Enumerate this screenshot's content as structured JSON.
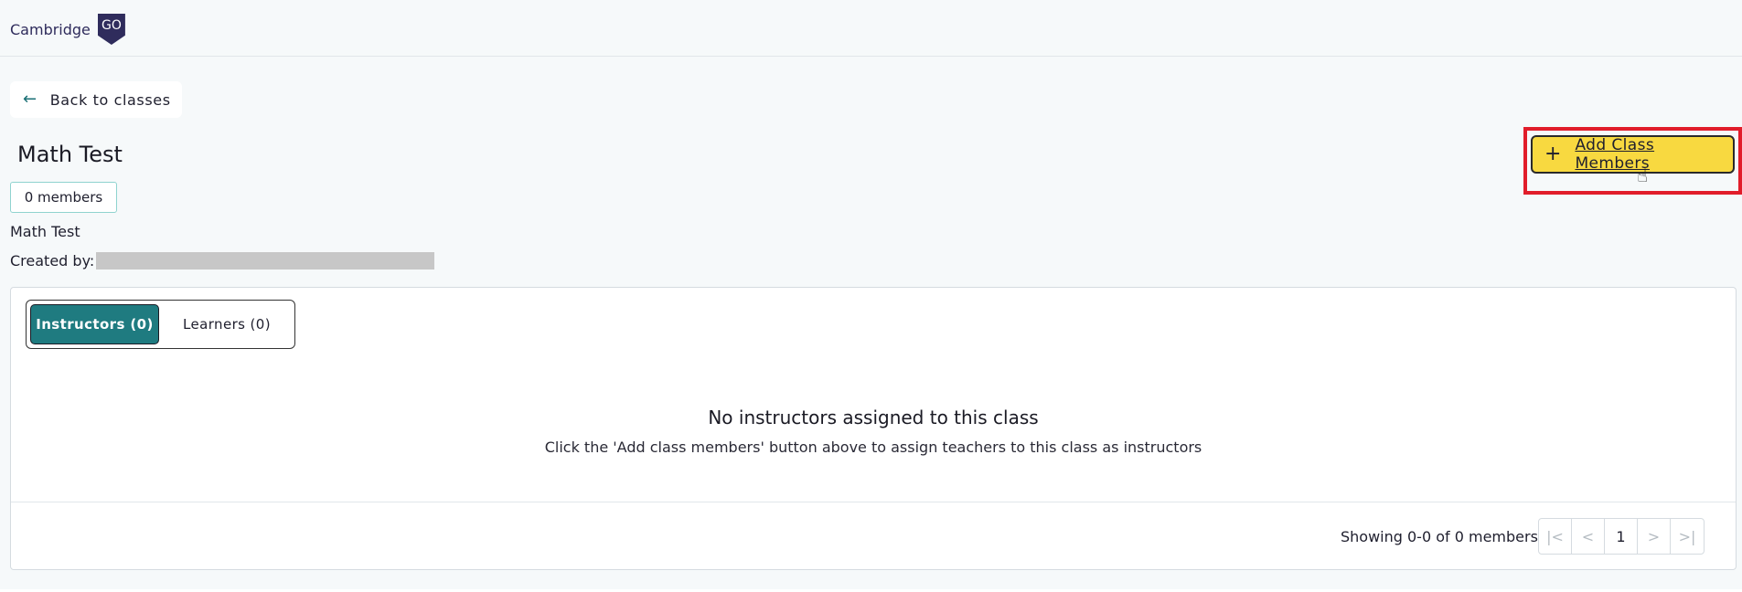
{
  "header": {
    "logo_text": "Cambridge",
    "logo_badge": "GO"
  },
  "back": {
    "label": "Back to classes",
    "icon": "arrow-left-icon"
  },
  "class": {
    "title": "Math Test",
    "members_badge": "0 members",
    "description": "Math Test",
    "created_by_label": "Created by:"
  },
  "actions": {
    "add_members_label": "Add Class Members",
    "add_icon": "+"
  },
  "tabs": [
    {
      "label": "Instructors (0)",
      "active": true
    },
    {
      "label": "Learners (0)",
      "active": false
    }
  ],
  "empty_state": {
    "title": "No instructors assigned to this class",
    "subtitle": "Click the 'Add class members' button above to assign teachers to this class as instructors"
  },
  "pagination": {
    "summary": "Showing 0-0 of 0 members",
    "first": "|<",
    "prev": "<",
    "page": "1",
    "next": ">",
    "last": ">|"
  },
  "colors": {
    "accent": "#1f7b80",
    "primary_button": "#f8d940",
    "highlight": "#e11d2a",
    "brand": "#2f2c5c"
  }
}
